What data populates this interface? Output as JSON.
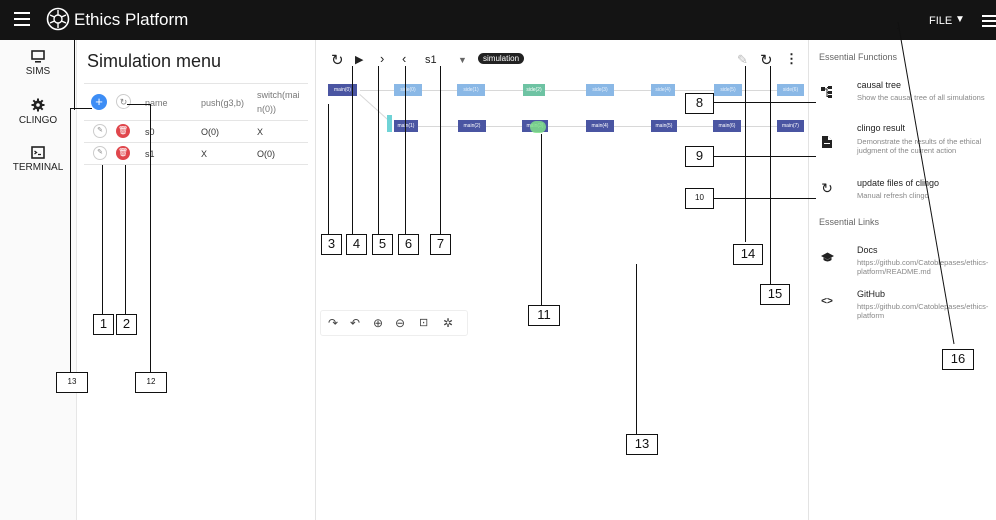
{
  "app": {
    "title": "Ethics Platform",
    "file_menu": "FILE"
  },
  "nav": [
    {
      "label": "SIMS",
      "icon": "monitor-icon"
    },
    {
      "label": "CLINGO",
      "icon": "gear-icon"
    },
    {
      "label": "TERMINAL",
      "icon": "terminal-icon"
    }
  ],
  "sim_menu": {
    "title": "Simulation menu",
    "columns": [
      "name",
      "push(g3,b)",
      "switch(mai",
      "n(0))"
    ],
    "rows": [
      {
        "name": "s0",
        "push": "O(0)",
        "switch": "X"
      },
      {
        "name": "s1",
        "push": "X",
        "switch": "O(0)"
      }
    ]
  },
  "toolbar": {
    "selected": "s1",
    "tag": "simulation"
  },
  "graph": {
    "top_row": [
      "main(0)",
      "side(0)",
      "side(1)",
      "side(2)",
      "side(3)",
      "side(4)",
      "side(5)",
      "side(6)"
    ],
    "bottom_row": [
      "main(1)",
      "main(2)",
      "main(3)",
      "main(4)",
      "main(5)",
      "main(6)",
      "main(7)"
    ]
  },
  "right_panel": {
    "functions_header": "Essential Functions",
    "functions": [
      {
        "title": "causal tree",
        "desc": "Show the causal tree of all simulations",
        "icon": "tree-icon"
      },
      {
        "title": "clingo result",
        "desc": "Demonstrate the results of the ethical judgment of the current action",
        "icon": "file-icon"
      },
      {
        "title": "update files of clingo",
        "desc": "Manual refresh clingo",
        "icon": "refresh-icon"
      }
    ],
    "links_header": "Essential Links",
    "links": [
      {
        "title": "Docs",
        "desc": "https://github.com/Catoblepases/ethics-platform/README.md",
        "icon": "school-icon"
      },
      {
        "title": "GitHub",
        "desc": "https://github.com/Catoblepases/ethics-platform",
        "icon": "code-icon"
      }
    ]
  },
  "annotations": [
    "1",
    "2",
    "3",
    "4",
    "5",
    "6",
    "7",
    "8",
    "9",
    "10",
    "11",
    "12",
    "13",
    "13",
    "14",
    "15",
    "16"
  ]
}
